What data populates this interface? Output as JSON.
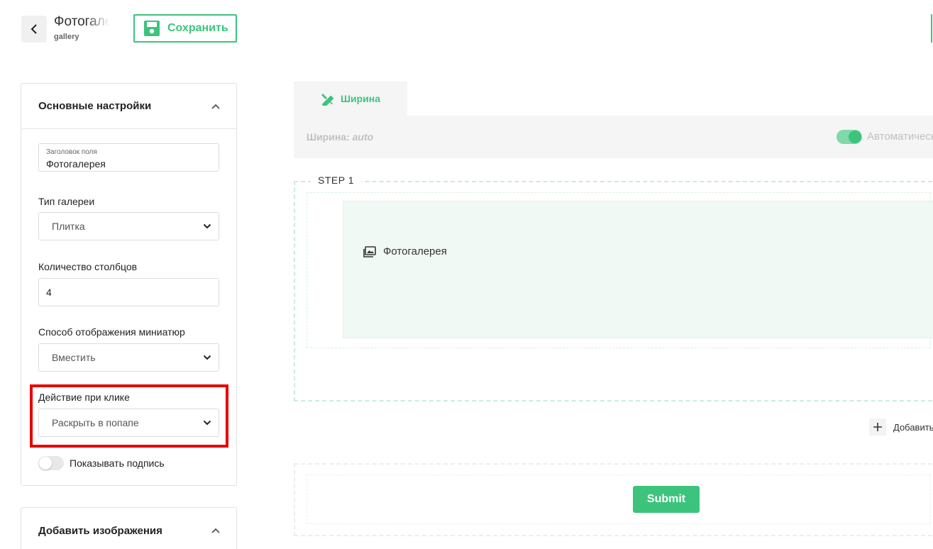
{
  "header": {
    "title": "Фотогалерея",
    "subtitle": "gallery",
    "save_label": "Сохранить"
  },
  "settings": {
    "section_title": "Основные настройки",
    "field_title": {
      "label": "Заголовок поля",
      "value": "Фотогалерея"
    },
    "gallery_type": {
      "label": "Тип галереи",
      "value": "Плитка"
    },
    "columns": {
      "label": "Количество столбцов",
      "value": "4"
    },
    "thumb_mode": {
      "label": "Способ отображения миниатюр",
      "value": "Вместить"
    },
    "click_action": {
      "label": "Действие при клике",
      "value": "Раскрыть в попапе"
    },
    "show_caption": {
      "label": "Показывать подпись",
      "on": false
    }
  },
  "images_section": {
    "title": "Добавить изображения"
  },
  "canvas": {
    "tab_label": "Ширина",
    "width_label": "Ширина:",
    "width_value": "auto",
    "auto_label": "Автоматически",
    "auto_on": true,
    "step_label": "STEP 1",
    "gallery_label": "Фотогалерея",
    "add_label": "Добавить",
    "submit_label": "Submit"
  },
  "colors": {
    "accent": "#3cc47c",
    "highlight": "#e60000"
  }
}
